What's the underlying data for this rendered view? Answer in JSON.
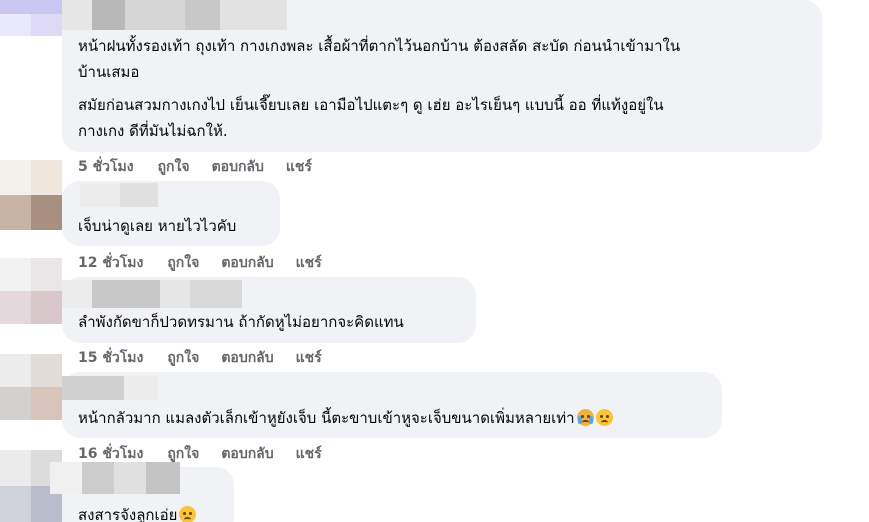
{
  "comments": [
    {
      "lines": [
        "หน้าฝนทั้งรองเท้า ถุงเท้า กางเกงพละ เสื้อผ้าที่ตากไว้นอกบ้าน ต้องสลัด สะบัด ก่อนนำเข้ามาใน",
        "บ้านเสมอ",
        "สมัยก่อนสวมกางเกงไป เย็นเจี๊ยบเลย เอามือไปแตะๆ ดู เฮ่ย อะไรเย็นๆ แบบนี้ ออ ที่แท้งูอยู่ใน",
        "กางเกง ดีที่มันไม่ฉกให้."
      ],
      "time": "5 ชั่วโมง"
    },
    {
      "lines": [
        "เจ็บน่าดูเลย หายไวไวคับ"
      ],
      "time": "12 ชั่วโมง"
    },
    {
      "lines": [
        "ลำพังกัดขาก็ปวดทรมาน ถ้ากัดหูไม่อยากจะคิดแทน"
      ],
      "time": "15 ชั่วโมง"
    },
    {
      "lines": [
        "หน้ากลัวมาก แมลงตัวเล็กเข้าหูยังเจ็บ นี้ตะขาบเข้าหูจะเจ็บขนาดเพิ่มหลายเท่า"
      ],
      "emojis": [
        "crying-face-icon",
        "sad-face-icon"
      ],
      "time": "16 ชั่วโมง"
    },
    {
      "lines": [
        "สงสารจังลูกเอ่ย"
      ],
      "emojis": [
        "sad-face-icon"
      ]
    }
  ],
  "actions": {
    "like": "ถูกใจ",
    "reply": "ตอบกลับ",
    "share": "แชร์"
  },
  "colors": {
    "bubble": "#f0f2f5",
    "meta": "#65676b",
    "text": "#050505"
  }
}
